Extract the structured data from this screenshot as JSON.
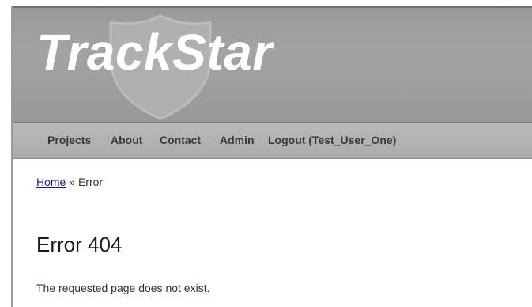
{
  "header": {
    "logo_text": "TrackStar"
  },
  "nav": {
    "items": [
      {
        "label": "Projects"
      },
      {
        "label": "About"
      },
      {
        "label": "Contact"
      },
      {
        "label": "Admin"
      },
      {
        "label": "Logout (Test_User_One)"
      }
    ]
  },
  "breadcrumb": {
    "home_label": "Home",
    "separator": "»",
    "current_label": "Error"
  },
  "main": {
    "title": "Error 404",
    "message": "The requested page does not exist."
  },
  "colors": {
    "header_bg": "#9a9a9a",
    "nav_bg": "#b4b4b4",
    "logo_text": "#ffffff",
    "link": "#1a1a9a"
  }
}
